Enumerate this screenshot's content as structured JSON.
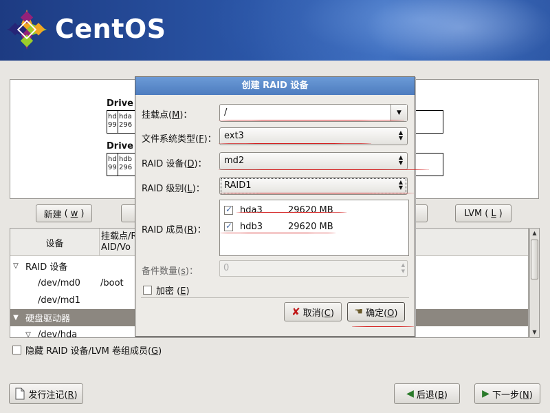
{
  "banner": {
    "logo_text": "CentOS"
  },
  "drives": [
    {
      "label": "Drive",
      "seg_labels": [
        "hd 99",
        "hda 296"
      ]
    },
    {
      "label": "Drive",
      "seg_labels": [
        "hd 99",
        "hdb 296"
      ]
    }
  ],
  "toolbar": {
    "new": "新建",
    "new_key": "w",
    "lvm": "LVM",
    "lvm_key": "L"
  },
  "tree": {
    "columns": [
      "设备",
      "挂载点/RAID/Vo"
    ],
    "rows": [
      {
        "label": "RAID 设备",
        "mount": "",
        "expanded": true,
        "level": 0
      },
      {
        "label": "/dev/md0",
        "mount": "/boot",
        "level": 1
      },
      {
        "label": "/dev/md1",
        "mount": "",
        "level": 1
      },
      {
        "label": "硬盘驱动器",
        "mount": "",
        "expanded": true,
        "level": 0,
        "selected": true
      },
      {
        "label": "/dev/hda",
        "mount": "",
        "expanded": true,
        "level": 1
      }
    ]
  },
  "hide_raid": {
    "label": "隐藏 RAID 设备/LVM 卷组成员",
    "key": "G",
    "checked": false
  },
  "bottom": {
    "release_notes": "发行注记",
    "release_key": "R",
    "back": "后退",
    "back_key": "B",
    "next": "下一步",
    "next_key": "N"
  },
  "dialog": {
    "title": "创建 RAID 设备",
    "mount_label": "挂载点",
    "mount_key": "M",
    "mount_value": "/",
    "fstype_label": "文件系统类型",
    "fstype_key": "F",
    "fstype_value": "ext3",
    "raiddev_label": "RAID 设备",
    "raiddev_key": "D",
    "raiddev_value": "md2",
    "level_label": "RAID 级别",
    "level_key": "L",
    "level_value": "RAID1",
    "members_label": "RAID 成员",
    "members_key": "R",
    "members": [
      {
        "name": "hda3",
        "size": "29620 MB",
        "checked": true
      },
      {
        "name": "hdb3",
        "size": "29620 MB",
        "checked": true
      }
    ],
    "spares_label": "备件数量",
    "spares_key": "s",
    "spares_value": "0",
    "encrypt_label": "加密",
    "encrypt_key": "E",
    "encrypt_checked": false,
    "cancel": "取消",
    "cancel_key": "C",
    "ok": "确定",
    "ok_key": "O"
  }
}
